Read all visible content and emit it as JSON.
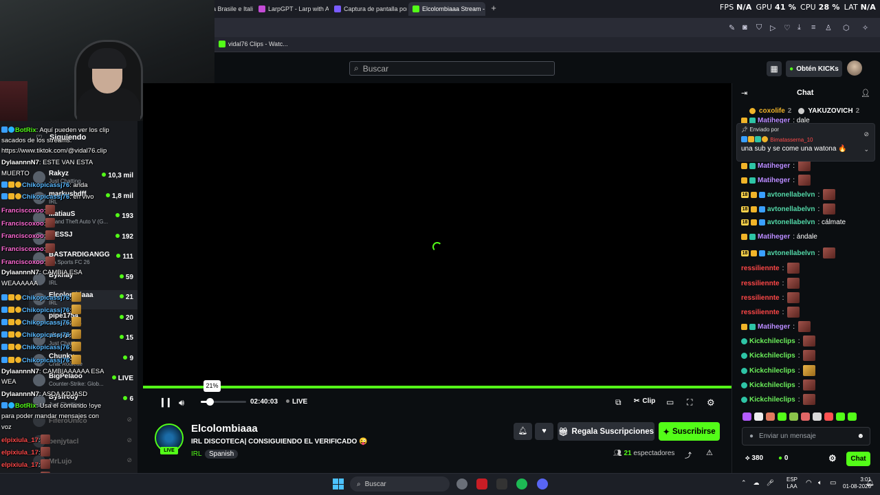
{
  "browser": {
    "tabs": [
      {
        "label": "ra Brasile e Itali"
      },
      {
        "label": "LarpGPT - Larp with AI"
      },
      {
        "label": "Captura de pantalla por L"
      },
      {
        "label": "Elcolombiaaa Stream - W"
      }
    ],
    "bookmark": "vidal76 Clips - Watc..."
  },
  "perf": {
    "fps_label": "FPS",
    "fps_value": "N/A",
    "gpu_label": "GPU",
    "gpu_value": "41 %",
    "cpu_label": "CPU",
    "cpu_value": "28 %",
    "lat_label": "LAT",
    "lat_value": "N/A"
  },
  "header": {
    "search_placeholder": "Buscar",
    "kicks_button": "Obtén KICKs"
  },
  "sidebar": {
    "title": "Siguiendo",
    "channels": [
      {
        "name": "Rakyz",
        "game": "Just Chatting",
        "count": "10,3 mil"
      },
      {
        "name": "markusbdff",
        "game": "IRL",
        "count": "1,8 mil"
      },
      {
        "name": "MatiauS",
        "game": "Grand Theft Auto V (G...",
        "count": "193"
      },
      {
        "name": "ITESSJ",
        "game": "",
        "count": "192"
      },
      {
        "name": "BASTARDIGANGG",
        "game": "EA Sports FC 26",
        "count": "111"
      },
      {
        "name": "Bykhay",
        "game": "IRL",
        "count": "59"
      },
      {
        "name": "Elcolombiaaa",
        "game": "IRL",
        "count": "21"
      },
      {
        "name": "pipe1754",
        "game": "Conversando",
        "count": "20"
      },
      {
        "name": "zitrosch",
        "game": "Just Chatting",
        "count": "15"
      },
      {
        "name": "Chunky",
        "game": "Chat Roulette",
        "count": "9"
      },
      {
        "name": "BigPelaoo",
        "game": "Counter-Strike: Glob...",
        "count": "LIVE"
      },
      {
        "name": "Bysfredy",
        "game": "Just Chatting",
        "count": "6"
      },
      {
        "name": "FiferoUnico",
        "game": "",
        "count": ""
      },
      {
        "name": "benjytacl",
        "game": "",
        "count": ""
      },
      {
        "name": "MrLujo",
        "game": "",
        "count": ""
      }
    ]
  },
  "overlay_chat": [
    {
      "user": "BotRix",
      "text": ": Aquí pueden ver los clip"
    },
    {
      "user": "",
      "text": "sacados de los streams:"
    },
    {
      "user": "",
      "text": "https://www.tiktok.com/@vidal76.clip"
    },
    {
      "user": "DylaannnN7",
      "text": ": ESTE VAN ESTA"
    },
    {
      "user": "",
      "text": "MUERTO"
    },
    {
      "user": "Chikopicassj76",
      "text": ": anda"
    },
    {
      "user": "Chikopicassj76",
      "text": ": en vivo"
    },
    {
      "user": "Franciscoxoo",
      "text": ":"
    },
    {
      "user": "Franciscoxoo",
      "text": ":"
    },
    {
      "user": "Franciscoxoo",
      "text": ":"
    },
    {
      "user": "Franciscoxoo",
      "text": ":"
    },
    {
      "user": "Franciscoxoo",
      "text": ":"
    },
    {
      "user": "DylaannnN7",
      "text": ": CAMBIA ESA"
    },
    {
      "user": "",
      "text": "WEAAAAAA"
    },
    {
      "user": "Chikopicassj76",
      "text": ":"
    },
    {
      "user": "Chikopicassj76",
      "text": ":"
    },
    {
      "user": "Chikopicassj76",
      "text": ":"
    },
    {
      "user": "Chikopicassj76",
      "text": ":"
    },
    {
      "user": "Chikopicassj76",
      "text": ":"
    },
    {
      "user": "Chikopicassj76",
      "text": ":"
    },
    {
      "user": "DylaannnN7",
      "text": ": CAMBIAAAAAA ESA"
    },
    {
      "user": "",
      "text": "WEA"
    },
    {
      "user": "DylaannnN7",
      "text": ": ASDA KDJASD"
    },
    {
      "user": "BotRix",
      "text": ": Usa el comando !oye"
    },
    {
      "user": "",
      "text": "para poder mandar mensajes con"
    },
    {
      "user": "",
      "text": "voz"
    },
    {
      "user": "elpixiula_17",
      "text": ":"
    },
    {
      "user": "elpixiula_17",
      "text": ":"
    },
    {
      "user": "elpixiula_17",
      "text": ":"
    },
    {
      "user": "elpixiula_17",
      "text": ":"
    }
  ],
  "player": {
    "volume_percent": "21%",
    "volume_level": 0.21,
    "time": "02:40:03",
    "live_label": "LIVE",
    "clip_label": "Clip"
  },
  "stream": {
    "live_badge": "LIVE",
    "channel": "Elcolombiaaa",
    "title": "IRL DISCOTECA| CONSIGUIENDO EL VERIFICADO 😜",
    "category": "IRL",
    "tag": "Spanish",
    "gift_button": "Regala Suscripciones",
    "subscribe_button": "Suscribirse",
    "viewers_count": "21",
    "viewers_label": "espectadores"
  },
  "chat": {
    "title": "Chat",
    "leaderboard": [
      {
        "name": "coxolife",
        "count": "2"
      },
      {
        "name": "YAKUZOVICH",
        "count": "2"
      }
    ],
    "pinned_label": "Enviado por",
    "pinned_user": "Bimatasserna_10",
    "pinned_text": "una sub y se come una watona 🔥",
    "messages": [
      {
        "user": "Matiheger",
        "text": ": dale",
        "color": "pur"
      },
      {
        "user": "Matiheger",
        "text": ":",
        "color": "pur"
      },
      {
        "user": "Matiheger",
        "text": ":",
        "color": "pur"
      },
      {
        "user": "avtonellabelvn",
        "text": ":",
        "color": "teal"
      },
      {
        "user": "avtonellabelvn",
        "text": ":",
        "color": "teal"
      },
      {
        "user": "avtonellabelvn",
        "text": ": cálmate",
        "color": "teal"
      },
      {
        "user": "Matiheger",
        "text": ": ándale",
        "color": "pur"
      },
      {
        "user": "avtonellabelvn",
        "text": ":",
        "color": "teal"
      },
      {
        "user": "ressiliennte",
        "text": ":",
        "color": "red"
      },
      {
        "user": "ressiliennte",
        "text": ":",
        "color": "red"
      },
      {
        "user": "ressiliennte",
        "text": ":",
        "color": "red"
      },
      {
        "user": "ressiliennte",
        "text": ":",
        "color": "red"
      },
      {
        "user": "Matiheger",
        "text": ":",
        "color": "pur"
      },
      {
        "user": "Kickchileclips",
        "text": ":",
        "color": "grn"
      },
      {
        "user": "Kickchileclips",
        "text": ":",
        "color": "grn"
      },
      {
        "user": "Kickchileclips",
        "text": ":",
        "color": "grn"
      },
      {
        "user": "Kickchileclips",
        "text": ":",
        "color": "grn"
      },
      {
        "user": "Kickchileclips",
        "text": ":",
        "color": "grn"
      }
    ],
    "input_placeholder": "Enviar un mensaje",
    "points": "380",
    "kicks": "0",
    "send_button": "Chat"
  },
  "taskbar": {
    "search_placeholder": "Buscar",
    "lang_top": "ESP",
    "lang_bottom": "LAA",
    "time": "3:01",
    "date": "01-08-2026"
  },
  "colors": {
    "accent": "#53fc18",
    "background": "#0b0e11",
    "panel": "#191b1f"
  }
}
